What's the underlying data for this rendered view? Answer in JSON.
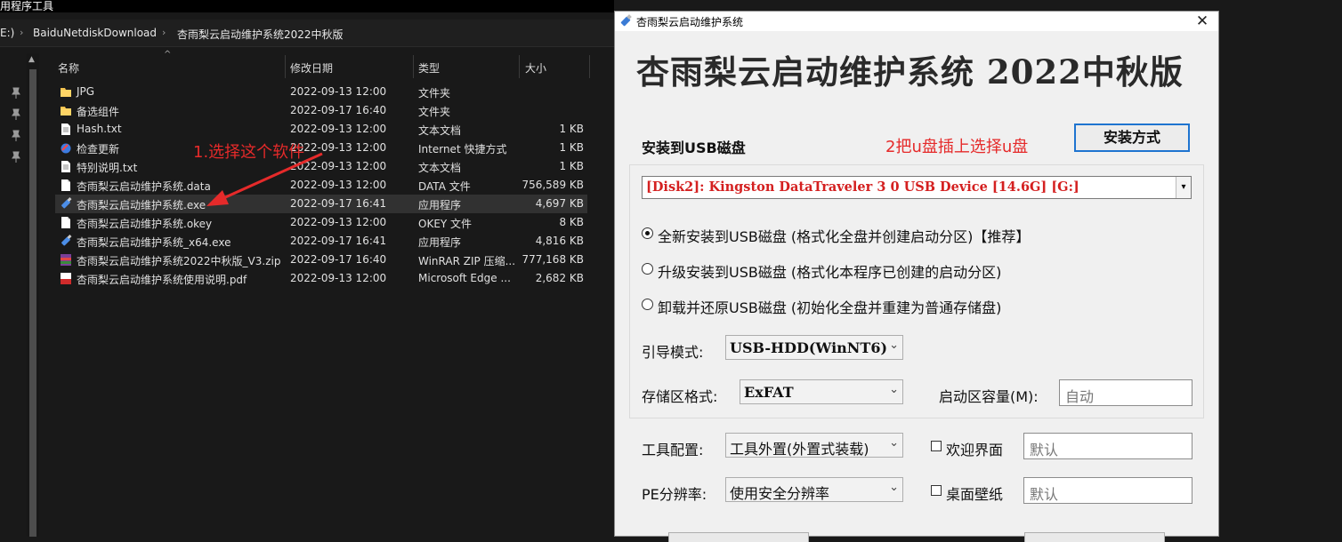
{
  "explorer": {
    "top_title": "用程序工具",
    "breadcrumb": [
      "E:)",
      "BaiduNetdiskDownload",
      "杏雨梨云启动维护系统2022中秋版"
    ],
    "columns": {
      "name": "名称",
      "date": "修改日期",
      "type": "类型",
      "size": "大小"
    },
    "files": [
      {
        "name": "JPG",
        "date": "2022-09-13 12:00",
        "type": "文件夹",
        "size": "",
        "icon": "folder-icon"
      },
      {
        "name": "备选组件",
        "date": "2022-09-17 16:40",
        "type": "文件夹",
        "size": "",
        "icon": "folder-icon"
      },
      {
        "name": "Hash.txt",
        "date": "2022-09-13 12:00",
        "type": "文本文档",
        "size": "1 KB",
        "icon": "text-file-icon"
      },
      {
        "name": "检查更新",
        "date": "2022-09-13 12:00",
        "type": "Internet 快捷方式",
        "size": "1 KB",
        "icon": "internet-shortcut-icon"
      },
      {
        "name": "特别说明.txt",
        "date": "2022-09-13 12:00",
        "type": "文本文档",
        "size": "1 KB",
        "icon": "text-file-icon"
      },
      {
        "name": "杏雨梨云启动维护系统.data",
        "date": "2022-09-13 12:00",
        "type": "DATA 文件",
        "size": "756,589 KB",
        "icon": "blank-file-icon"
      },
      {
        "name": "杏雨梨云启动维护系统.exe",
        "date": "2022-09-17 16:41",
        "type": "应用程序",
        "size": "4,697 KB",
        "icon": "usb-app-icon"
      },
      {
        "name": "杏雨梨云启动维护系统.okey",
        "date": "2022-09-13 12:00",
        "type": "OKEY 文件",
        "size": "8 KB",
        "icon": "blank-file-icon"
      },
      {
        "name": "杏雨梨云启动维护系统_x64.exe",
        "date": "2022-09-17 16:41",
        "type": "应用程序",
        "size": "4,816 KB",
        "icon": "usb-app-icon"
      },
      {
        "name": "杏雨梨云启动维护系统2022中秋版_V3.zip",
        "date": "2022-09-17 16:40",
        "type": "WinRAR ZIP 压缩...",
        "size": "777,168 KB",
        "icon": "winrar-icon"
      },
      {
        "name": "杏雨梨云启动维护系统使用说明.pdf",
        "date": "2022-09-13 12:00",
        "type": "Microsoft Edge ...",
        "size": "2,682 KB",
        "icon": "pdf-icon"
      }
    ],
    "selected_index": 6
  },
  "annotations": {
    "step1": "1.选择这个软件",
    "step2": "2把u盘插上选择u盘"
  },
  "dialog": {
    "title": "杏雨梨云启动维护系统",
    "close_glyph": "✕",
    "banner": "杏雨梨云启动维护系统 2022中秋版",
    "install_to_label": "安装到USB磁盘",
    "install_mode_button": "安装方式",
    "disk_selected": "[Disk2]:  Kingston DataTraveler 3 0 USB Device  [14.6G]  [G:]",
    "options": [
      "全新安装到USB磁盘 (格式化全盘并创建启动分区)【推荐】",
      "升级安装到USB磁盘 (格式化本程序已创建的启动分区)",
      "卸载并还原USB磁盘 (初始化全盘并重建为普通存储盘)"
    ],
    "selected_option": 0,
    "boot_mode_label": "引导模式:",
    "boot_mode_value": "USB-HDD(WinNT6)",
    "storage_format_label": "存储区格式:",
    "storage_format_value": "ExFAT",
    "boot_capacity_label": "启动区容量(M):",
    "boot_capacity_value": "自动",
    "tool_config_label": "工具配置:",
    "tool_config_value": "工具外置(外置式装载)",
    "welcome_label": "欢迎界面",
    "welcome_value": "默认",
    "pe_resolution_label": "PE分辨率:",
    "pe_resolution_value": "使用安全分辨率",
    "wallpaper_label": "桌面壁纸",
    "wallpaper_value": "默认"
  },
  "colors": {
    "annotation": "#e52a2a",
    "disk_text": "#d42020",
    "accent_border": "#1e74d0",
    "explorer_bg": "#191919"
  }
}
